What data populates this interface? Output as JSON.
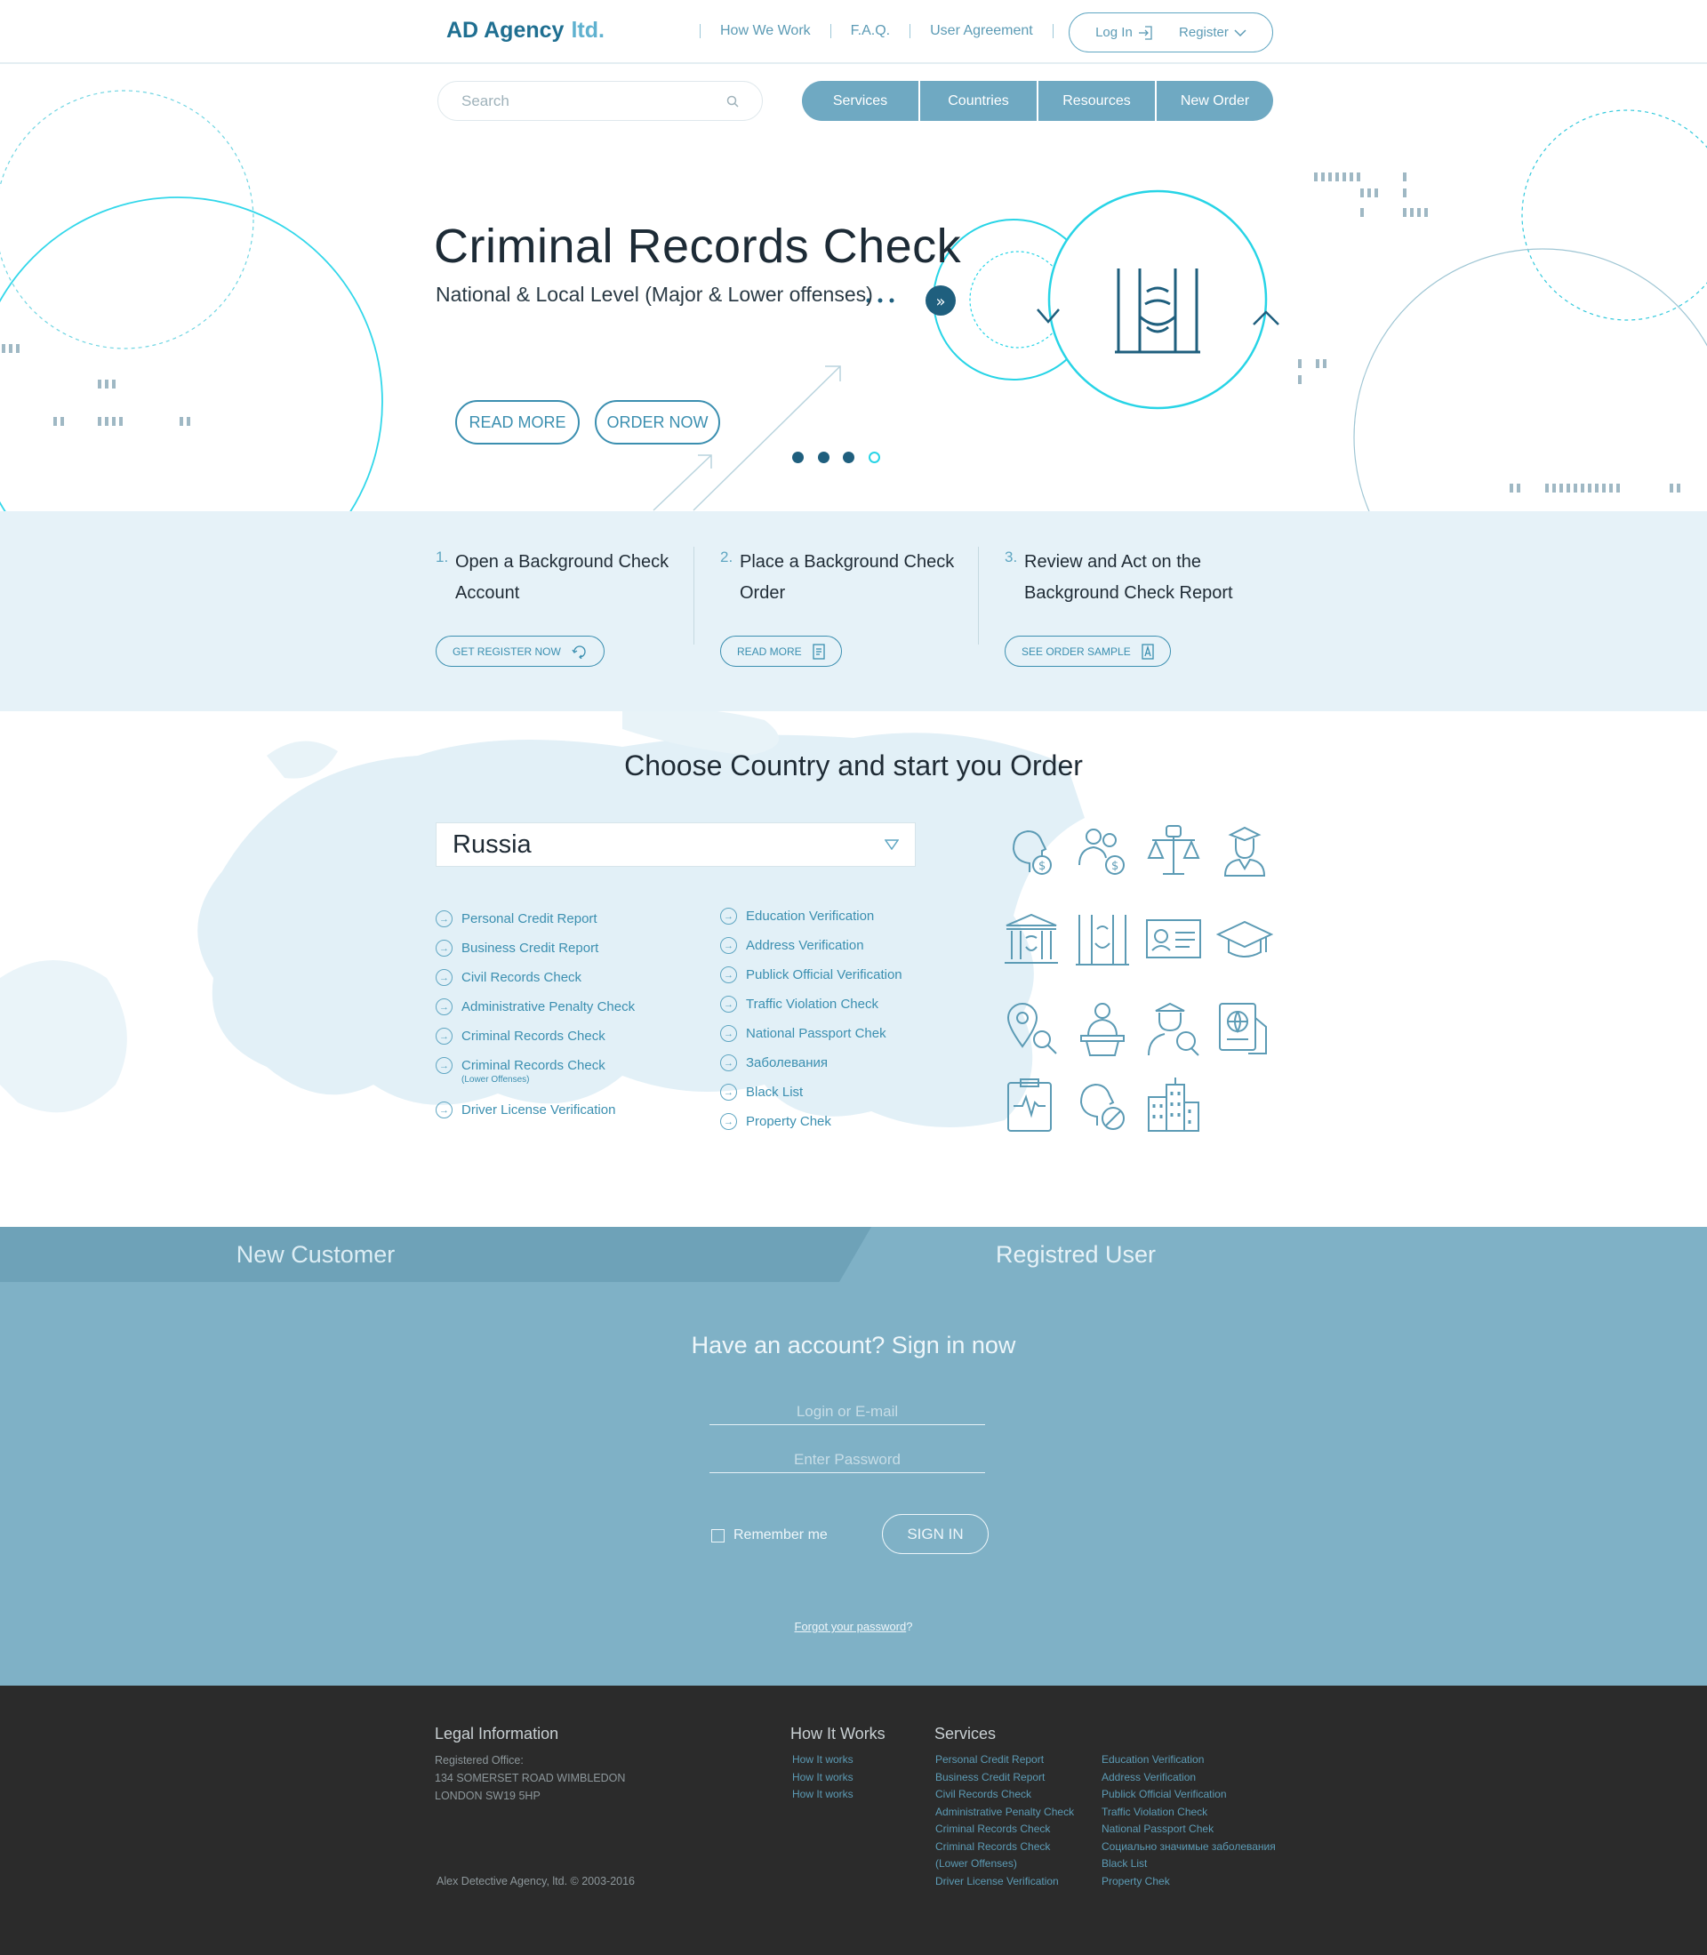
{
  "header": {
    "logo_main": "AD Agency",
    "logo_ltd": "ltd.",
    "nav": [
      "How  We  Work",
      "F.A.Q.",
      "User  Agreement"
    ],
    "login": "Log  In",
    "register": "Register"
  },
  "search": {
    "placeholder": "Search"
  },
  "mainnav": [
    "Services",
    "Countries",
    "Resources",
    "New  Order"
  ],
  "hero": {
    "title": "Criminal Records Check",
    "subtitle": "National & Local Level (Major & Lower offenses)",
    "read_more": "READ MORE",
    "order_now": "ORDER NOW",
    "slide_count": 4,
    "active_slide": 4
  },
  "steps": [
    {
      "num": "1.",
      "text": "Open a Background Check Account",
      "button": "GET REGISTER NOW"
    },
    {
      "num": "2.",
      "text": "Place a Background Check Order",
      "button": "READ MORE"
    },
    {
      "num": "3.",
      "text": "Review and Act on the Background Check Report",
      "button": "SEE ORDER SAMPLE"
    }
  ],
  "country": {
    "title": "Choose Country and start you Order",
    "selected": "Russia",
    "services_left": [
      {
        "label": "Personal Credit Report"
      },
      {
        "label": "Business Credit Report"
      },
      {
        "label": "Civil Records Check"
      },
      {
        "label": "Administrative Penalty Check"
      },
      {
        "label": "Criminal Records Check"
      },
      {
        "label": "Criminal Records Check",
        "note": "(Lower Offenses)"
      },
      {
        "label": "Driver License Verification"
      }
    ],
    "services_right": [
      {
        "label": "Education Verification"
      },
      {
        "label": "Address Verification"
      },
      {
        "label": "Publick Official Verification"
      },
      {
        "label": "Traffic Violation Check"
      },
      {
        "label": "National Passport Chek"
      },
      {
        "label": "Заболевания"
      },
      {
        "label": "Black List"
      },
      {
        "label": "Property Chek"
      }
    ],
    "icons": [
      "head-dollar-icon",
      "group-dollar-icon",
      "justice-scales-icon",
      "judge-icon",
      "courthouse-icon",
      "prison-bars-icon",
      "id-card-icon",
      "graduation-cap-icon",
      "location-search-icon",
      "official-podium-icon",
      "officer-search-icon",
      "passport-icon",
      "medical-clipboard-icon",
      "head-blocked-icon",
      "buildings-icon"
    ]
  },
  "login": {
    "tab_new": "New Customer",
    "tab_registered": "Registred User",
    "title": "Have an account? Sign in now",
    "login_placeholder": "Login or E-mail",
    "password_placeholder": "Enter Password",
    "remember": "Remember me",
    "signin": "SIGN IN",
    "forgot_link": "Forgot your password",
    "forgot_suffix": "?"
  },
  "footer": {
    "legal_title": "Legal Information",
    "legal_lines": [
      "Registered Office:",
      "134 SOMERSET ROAD WIMBLEDON",
      "LONDON  SW19 5HP"
    ],
    "copyright": "Alex Detective Agency, ltd.  ©  2003-2016",
    "how_title": "How It Works",
    "how_links": [
      "How It works",
      "How It works",
      "How It works"
    ],
    "services_title": "Services",
    "services_col1": [
      "Personal Credit Report",
      "Business Credit Report",
      "Civil Records Check",
      "Administrative Penalty Check",
      "Criminal Records Check",
      "Criminal Records Check",
      "(Lower Offenses)",
      "Driver License Verification"
    ],
    "services_col2": [
      "Education Verification",
      "Address Verification",
      "Publick Official Verification",
      "Traffic Violation Check",
      "National Passport Chek",
      "Социально значимые заболевания",
      "Black List",
      "Property Chek"
    ]
  },
  "colors": {
    "accent": "#3b8fb0",
    "nav_bg": "#6fa9c2",
    "steps_bg": "#e6f2f8",
    "login_bg": "#7fb1c6",
    "footer_bg": "#2b2b2b",
    "hero_ring": "#27d4e6"
  }
}
